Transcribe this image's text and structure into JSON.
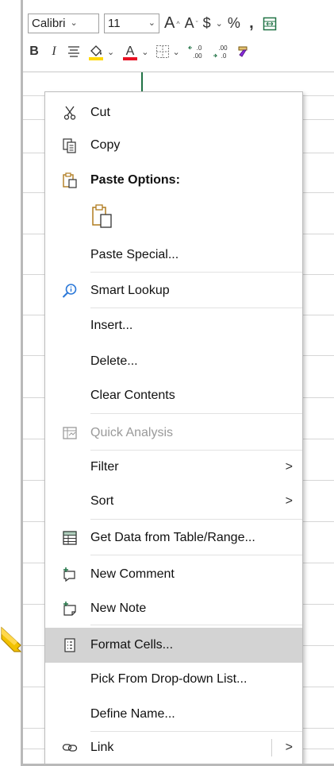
{
  "toolbar": {
    "font_name": "Calibri",
    "font_size": "11",
    "increase_font": "A",
    "decrease_font": "A",
    "currency": "$",
    "percent": "%",
    "comma": ",",
    "bold": "B",
    "italic": "I",
    "decimal_inc_top": ".0",
    "decimal_inc_bottom": ".00",
    "decimal_dec_top": ".00",
    "decimal_dec_bottom": ".0"
  },
  "menu": {
    "cut": "Cut",
    "copy": "Copy",
    "paste_options": "Paste Options:",
    "paste_special": "Paste Special...",
    "smart_lookup": "Smart Lookup",
    "insert": "Insert...",
    "delete": "Delete...",
    "clear_contents": "Clear Contents",
    "quick_analysis": "Quick Analysis",
    "filter": "Filter",
    "sort": "Sort",
    "get_data": "Get Data from Table/Range...",
    "new_comment": "New Comment",
    "new_note": "New Note",
    "format_cells": "Format Cells...",
    "pick_from_list": "Pick From Drop-down List...",
    "define_name": "Define Name...",
    "link": "Link",
    "submenu_arrow": ">"
  },
  "colors": {
    "accent_green": "#217346",
    "highlight_yellow": "#ffd800",
    "font_red": "#e81123",
    "highlight_item": "#d3d3d3",
    "pointer": "#f2c200"
  }
}
